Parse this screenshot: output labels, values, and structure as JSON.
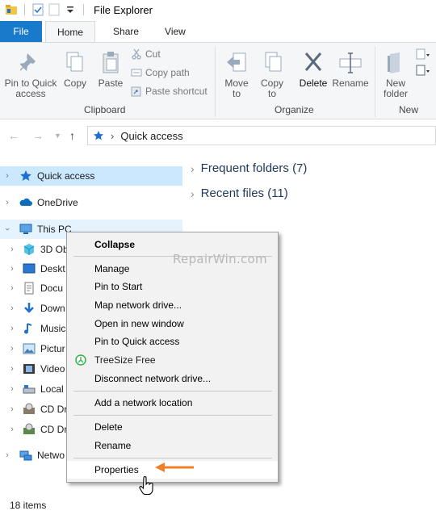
{
  "window": {
    "title": "File Explorer"
  },
  "tabs": [
    {
      "label": "File"
    },
    {
      "label": "Home"
    },
    {
      "label": "Share"
    },
    {
      "label": "View"
    }
  ],
  "ribbon": {
    "clipboard": {
      "pin": "Pin to Quick access",
      "copy": "Copy",
      "paste": "Paste",
      "cut": "Cut",
      "copy_path": "Copy path",
      "paste_shortcut": "Paste shortcut",
      "label": "Clipboard"
    },
    "organize": {
      "move_to": "Move to",
      "copy_to": "Copy to",
      "delete": "Delete",
      "rename": "Rename",
      "label": "Organize"
    },
    "new": {
      "new_folder": "New folder",
      "label": "New"
    }
  },
  "address": {
    "location": "Quick access"
  },
  "nav_pane": {
    "items": [
      {
        "label": "Quick access",
        "icon": "star-icon"
      },
      {
        "label": "OneDrive",
        "icon": "cloud-icon"
      },
      {
        "label": "This PC",
        "icon": "computer-icon"
      },
      {
        "label": "3D Ob",
        "icon": "cube-icon"
      },
      {
        "label": "Deskt",
        "icon": "desktop-icon"
      },
      {
        "label": "Docu",
        "icon": "document-icon"
      },
      {
        "label": "Down",
        "icon": "download-icon"
      },
      {
        "label": "Music",
        "icon": "music-icon"
      },
      {
        "label": "Pictur",
        "icon": "picture-icon"
      },
      {
        "label": "Video",
        "icon": "video-icon"
      },
      {
        "label": "Local",
        "icon": "disk-icon"
      },
      {
        "label": "CD Dr",
        "icon": "cd-drive-icon"
      },
      {
        "label": "CD Dr",
        "icon": "cd-drive-icon"
      },
      {
        "label": "Netwo",
        "icon": "network-icon"
      }
    ]
  },
  "content": {
    "groups": [
      {
        "label": "Frequent folders (7)"
      },
      {
        "label": "Recent files (11)"
      }
    ]
  },
  "context_menu": {
    "items": [
      "Collapse",
      "Manage",
      "Pin to Start",
      "Map network drive...",
      "Open in new window",
      "Pin to Quick access",
      "TreeSize Free",
      "Disconnect network drive...",
      "Add a network location",
      "Delete",
      "Rename",
      "Properties"
    ],
    "watermark": "RepairWin.com",
    "accent_color": "#f07f2a"
  },
  "status": {
    "item_count": "18 items"
  },
  "colors": {
    "file_tab": "#1979ca",
    "selection": "#cce8ff",
    "group_text": "#1e395b"
  }
}
